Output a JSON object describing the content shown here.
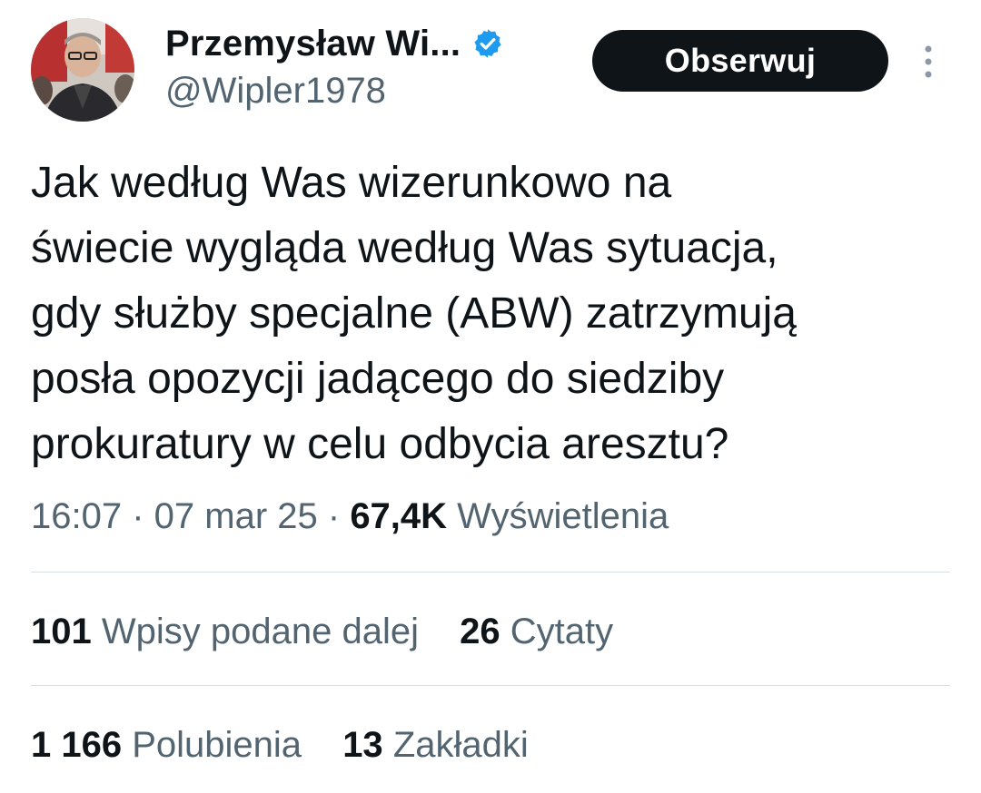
{
  "author": {
    "display_name": "Przemysław Wi...",
    "handle": "@Wipler1978",
    "verified_color": "#1d9bf0",
    "avatar_icon": "profile-photo"
  },
  "follow_button": {
    "label": "Obserwuj"
  },
  "more_icon": "more-vertical-icon",
  "tweet": {
    "lines": [
      "Jak według Was wizerunkowo na",
      "świecie wygląda według Was sytuacja,",
      "gdy służby specjalne (ABW) zatrzymują",
      "posła opozycji jadącego do siedziby",
      "prokuratury w celu odbycia aresztu?"
    ]
  },
  "meta": {
    "time": "16:07",
    "separator": " · ",
    "date": "07 mar 25",
    "views_count": "67,4K",
    "views_label": " Wyświetlenia"
  },
  "stats": {
    "reposts_count": "101",
    "reposts_label": "Wpisy podane dalej",
    "quotes_count": "26",
    "quotes_label": "Cytaty",
    "likes_count": "1 166",
    "likes_label": "Polubienia",
    "bookmarks_count": "13",
    "bookmarks_label": "Zakładki"
  },
  "colors": {
    "text_primary": "#0f1419",
    "text_secondary": "#536471",
    "divider": "#dadfe3",
    "button_bg": "#0f1419",
    "button_text": "#ffffff"
  }
}
